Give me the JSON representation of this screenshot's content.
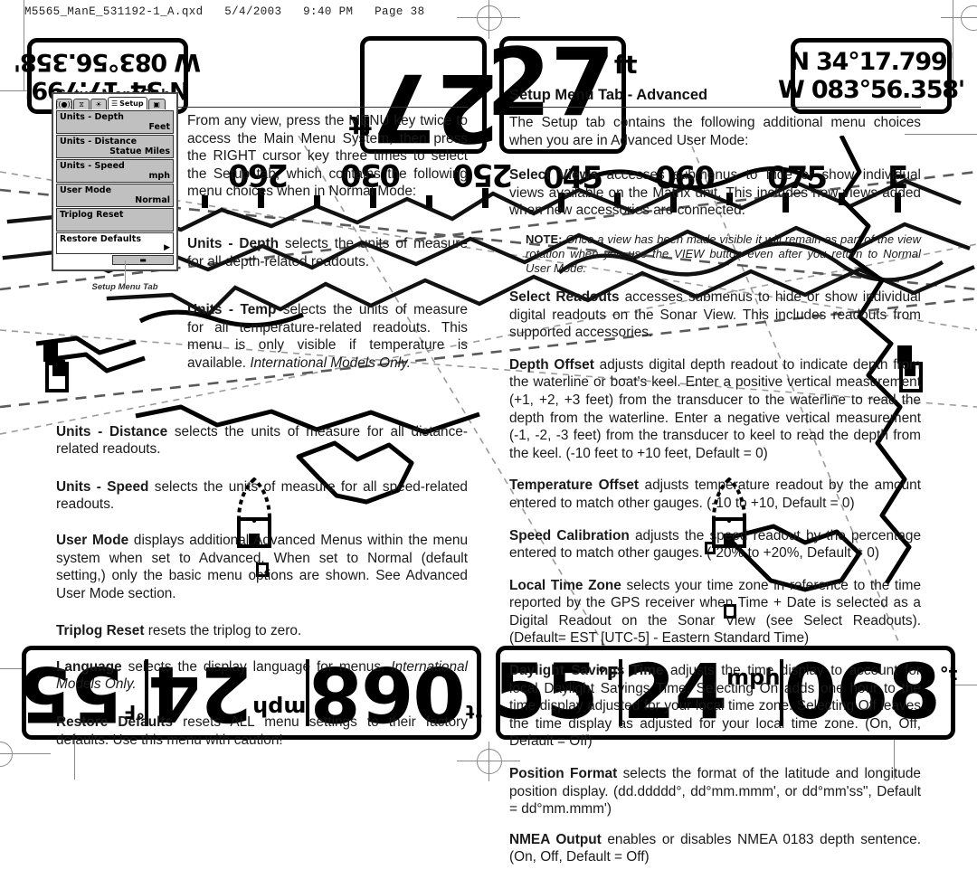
{
  "print_header": "M5565_ManE_531192-1_A.qxd   5/4/2003   9:40 PM   Page 38",
  "left_column": {
    "heading": "Setup Menu Tab",
    "paragraphs": [
      {
        "lead": "",
        "text": "From any view, press the MENU key twice to access the Main Menu System, then press the RIGHT cursor key three times to select the Setup tab, which contains the following menu choices when in Normal Mode:"
      },
      {
        "lead": "Units - Depth",
        "text": " selects the units of measure for all depth-related readouts."
      },
      {
        "lead": "Units - Temp",
        "text": " selects the units of measure for all temperature-related readouts. This menu is only visible if temperature is available. ",
        "italic": "International Models Only."
      },
      {
        "lead": "Units - Distance",
        "text": " selects the units of measure for all distance-related readouts."
      },
      {
        "lead": "Units - Speed",
        "text": " selects the units of measure for all speed-related readouts."
      },
      {
        "lead": "User Mode",
        "text": " displays additional Advanced Menus within the menu system when set to Advanced. When set to Normal (default setting,) only the basic menu options are shown.  See Advanced User Mode section."
      },
      {
        "lead": "Triplog Reset",
        "text": " resets the triplog to zero."
      },
      {
        "lead": "Language",
        "text": " selects the display language for menus. ",
        "italic": "International Models Only."
      },
      {
        "lead": "Restore Defaults",
        "text": " resets ALL menu settings to their factory defaults. Use this menu with caution!"
      }
    ]
  },
  "right_column": {
    "heading": "Setup Menu Tab - Advanced",
    "paragraphs": [
      {
        "lead": "",
        "text": "The Setup tab contains the following additional menu choices when you are in Advanced User Mode:"
      },
      {
        "lead": "Select Views",
        "text": " accesses submenus to hide or show individual views available on the Matrix unit. This includes new views added when new accessories are connected."
      }
    ],
    "note": {
      "label": "NOTE:",
      "text": " Once a view has been made visible it will remain as part of the view rotation when you use the VIEW button even after you return to Normal User Mode."
    },
    "paragraphs2": [
      {
        "lead": "Select Readouts",
        "text": " accesses submenus to hide or show individual digital readouts on the Sonar View. This includes readouts from supported accessories."
      },
      {
        "lead": "Depth Offset",
        "text": " adjusts digital depth readout to indicate depth from the waterline or boat's keel. Enter a positive vertical measurement (+1, +2, +3 feet) from the transducer to the waterline to read the depth from the waterline. Enter a negative vertical measurement (-1, -2, -3 feet) from the transducer to keel to read the depth from the keel. (-10 feet to +10 feet, Default = 0)"
      },
      {
        "lead": "Temperature Offset",
        "text": " adjusts temperature readout by the amount entered to match other gauges. (-10 to +10, Default = 0)"
      },
      {
        "lead": "Speed Calibration",
        "text": " adjusts the speed readout by the percentage entered to match other gauges. (-20% to +20%, Default = 0)"
      },
      {
        "lead": "Local Time Zone",
        "text": " selects your time zone in reference to the time reported by the GPS receiver when Time + Date is selected as a Digital Readout on the Sonar View (see Select Readouts). (Default= EST [UTC-5] - Eastern Standard Time)"
      },
      {
        "lead": "Daylight Savings Time",
        "text": " adjusts the time display to account for local Daylight Savings Time. Selecting On adds one hour to the time display adjusted for your local time zone. Selecting Off leaves the time display as adjusted for your local time zone. (On, Off, Default = Off)"
      },
      {
        "lead": "Position Format",
        "text": " selects the format of the latitude and longitude position display. (dd.ddddd°, dd°mm.mmm', or dd°mm'ss\", Default = dd°mm.mmm')"
      },
      {
        "lead": "NMEA Output",
        "text": " enables or disables NMEA 0183 depth sentence. (On, Off, Default = Off)"
      }
    ]
  },
  "menu_screenshot": {
    "caption": "Setup Menu Tab",
    "tabs": [
      {
        "name": "alarms-tab",
        "glyph": "((●))",
        "selected": false
      },
      {
        "name": "sonar-tab",
        "glyph": "⧖",
        "selected": false
      },
      {
        "name": "display-tab",
        "glyph": "☀",
        "selected": false
      },
      {
        "name": "setup-tab",
        "glyph": "☰",
        "label": "Setup",
        "selected": true
      },
      {
        "name": "views-tab",
        "glyph": "▣",
        "selected": false
      }
    ],
    "items": [
      {
        "title": "Units - Depth",
        "value": "Feet"
      },
      {
        "title": "Units - Distance",
        "value": "Statue Miles"
      },
      {
        "title": "Units - Speed",
        "value": "mph"
      },
      {
        "title": "User Mode",
        "value": "Normal"
      },
      {
        "title": "Triplog Reset",
        "value": ""
      },
      {
        "title": "Restore Defaults",
        "value": "",
        "arrow": "▶"
      }
    ],
    "scroll_glyph": "▬"
  },
  "readouts": {
    "gps_top_right": {
      "lat": "N 34°17.799'",
      "lon": "W 083°56.358'"
    },
    "gps_top_left_rotated": {
      "lat": "N 34°17.799'",
      "lon": "W 083°56.358'"
    },
    "depth_center_left_rotated": {
      "value": "27",
      "unit": "ft"
    },
    "depth_center_right": {
      "value": "27",
      "unit": "ft"
    },
    "bottom_strip_right": [
      {
        "name": "temperature",
        "value": "55",
        "unit": "°F"
      },
      {
        "name": "speed",
        "value": "24",
        "unit": "mph"
      },
      {
        "name": "heading",
        "value": "068",
        "unit": "°t"
      }
    ],
    "bottom_strip_left_rotated": [
      {
        "name": "heading",
        "value": "068",
        "unit": "°t"
      },
      {
        "name": "speed",
        "value": "24",
        "unit": "mph"
      },
      {
        "name": "temperature",
        "value": "55",
        "unit": "°F"
      }
    ]
  },
  "compass_tape": {
    "left_rotated_labels": [
      "250",
      "030",
      "260"
    ],
    "right_labels": [
      "045",
      "060",
      "075",
      "E"
    ]
  },
  "colors": {
    "ink": "#1a1a1a",
    "rule": "#333333",
    "crop_mark": "#8a8a8a",
    "menu_fill": "#c0c0c0",
    "map_land": "#000000",
    "map_grid": "#9a9a9a"
  }
}
